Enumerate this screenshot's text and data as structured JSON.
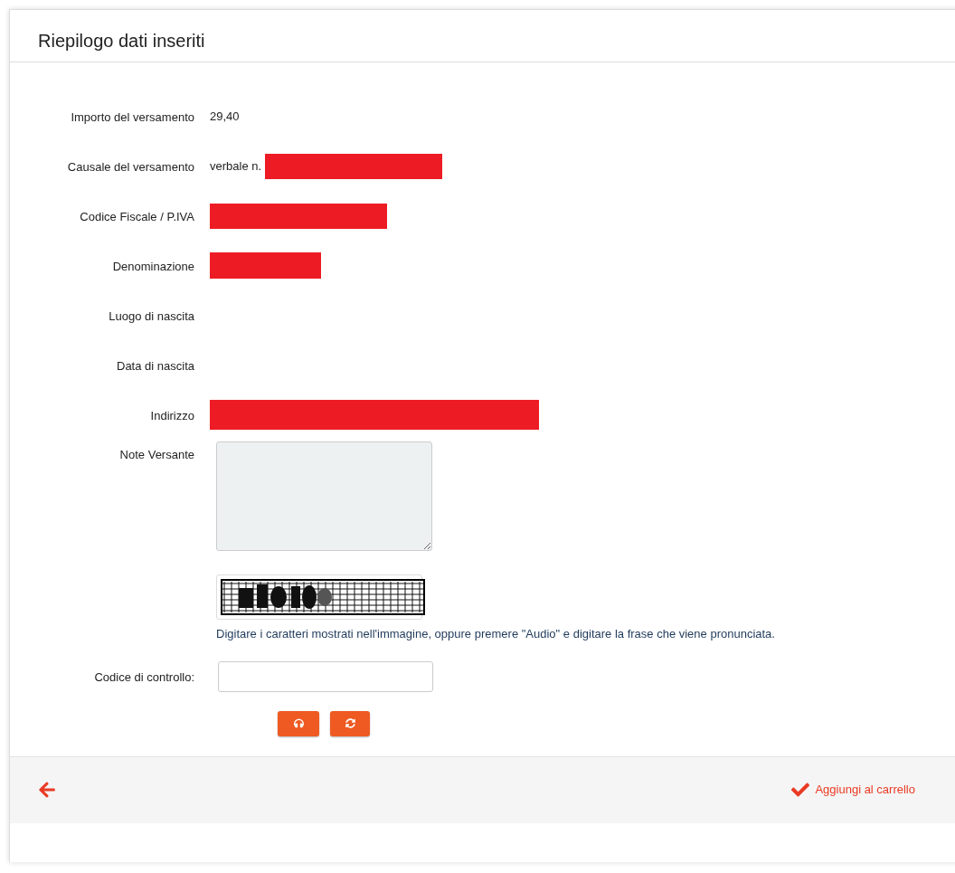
{
  "header": {
    "title": "Riepilogo dati inseriti"
  },
  "fields": [
    {
      "label": "Importo del versamento",
      "value": "29,40",
      "redacted": false
    },
    {
      "label": "Causale del versamento",
      "value": "verbale n.",
      "redacted": true
    },
    {
      "label": "Codice Fiscale / P.IVA",
      "redacted": true
    },
    {
      "label": "Denominazione",
      "redacted": true
    },
    {
      "label": "Luogo di nascita",
      "redacted": false
    },
    {
      "label": "Data di nascita",
      "redacted": false
    },
    {
      "label": "Indirizzo",
      "redacted": true
    }
  ],
  "notes": {
    "label": "Note Versante",
    "disabled": true
  },
  "captcha": {
    "hint": "Digitare i caratteri mostrati nell'immagine, oppure premere \"Audio\" e digitare la frase che viene pronunciata."
  },
  "control_code": {
    "label": "Codice di controllo:"
  },
  "footer": {
    "add_to_cart": "Aggiungi al carrello"
  }
}
